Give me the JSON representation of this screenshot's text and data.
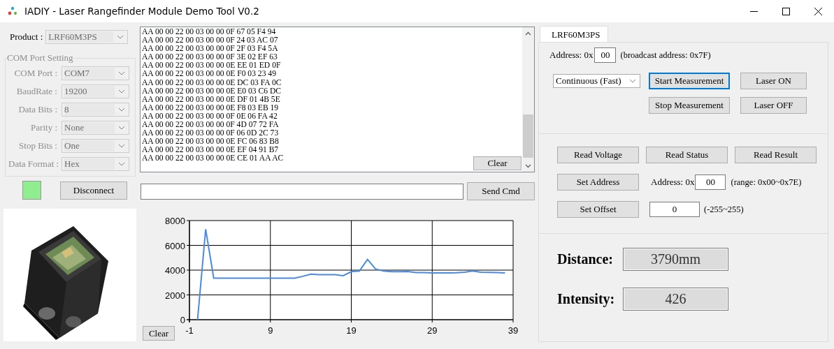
{
  "window": {
    "title": "IADIY - Laser Rangefinder Module Demo Tool V0.2"
  },
  "product": {
    "label": "Product :",
    "value": "LRF60M3PS",
    "disabled": true
  },
  "com_port_setting": {
    "title": "COM Port Setting",
    "disabled": true,
    "fields": [
      {
        "label": "COM Port :",
        "value": "COM7"
      },
      {
        "label": "BaudRate :",
        "value": "19200"
      },
      {
        "label": "Data Bits :",
        "value": "8"
      },
      {
        "label": "Parity :",
        "value": "None"
      },
      {
        "label": "Stop Bits :",
        "value": "One"
      },
      {
        "label": "Data Format :",
        "value": "Hex"
      }
    ]
  },
  "connection": {
    "connected": true,
    "button": "Disconnect"
  },
  "log": {
    "lines": [
      "AA 00 00 22 00 03 00 00 0F 67 05 F4 94",
      "AA 00 00 22 00 03 00 00 0F 24 03 AC 07",
      "AA 00 00 22 00 03 00 00 0F 2F 03 F4 5A",
      "AA 00 00 22 00 03 00 00 0F 3E 02 EF 63",
      "AA 00 00 22 00 03 00 00 0E EE 01 ED 0F",
      "AA 00 00 22 00 03 00 00 0E F0 03 23 49",
      "AA 00 00 22 00 03 00 00 0E DC 03 FA 0C",
      "AA 00 00 22 00 03 00 00 0E E0 03 C6 DC",
      "AA 00 00 22 00 03 00 00 0E DF 01 4B 5E",
      "AA 00 00 22 00 03 00 00 0E F8 03 EB 19",
      "AA 00 00 22 00 03 00 00 0F 0E 06 FA 42",
      "AA 00 00 22 00 03 00 00 0F 4D 07 72 FA",
      "AA 00 00 22 00 03 00 00 0F 06 0D 2C 73",
      "AA 00 00 22 00 03 00 00 0E FC 06 83 B8",
      "AA 00 00 22 00 03 00 00 0E EF 04 91 B7",
      "AA 00 00 22 00 03 00 00 0E CE 01 AA AC"
    ],
    "clear_button": "Clear"
  },
  "command": {
    "send_button": "Send Cmd"
  },
  "chart": {
    "clear_button": "Clear",
    "chart_data": {
      "type": "line",
      "x": [
        0,
        1,
        2,
        3,
        4,
        5,
        6,
        7,
        8,
        9,
        10,
        11,
        12,
        13,
        14,
        15,
        16,
        17,
        18,
        19,
        20,
        21,
        22,
        23,
        24,
        25,
        26,
        27,
        28,
        29,
        30,
        31,
        32,
        33,
        34,
        35,
        36,
        37,
        38
      ],
      "series": [
        {
          "color": "#4a8ae0",
          "values": [
            0,
            7300,
            3350,
            3350,
            3350,
            3350,
            3350,
            3350,
            3350,
            3350,
            3350,
            3350,
            3350,
            3500,
            3680,
            3630,
            3630,
            3630,
            3550,
            3870,
            3930,
            4870,
            4090,
            3930,
            3870,
            3870,
            3880,
            3800,
            3800,
            3780,
            3780,
            3780,
            3790,
            3830,
            3930,
            3830,
            3820,
            3800,
            3780
          ]
        }
      ],
      "xlim": [
        -1,
        39
      ],
      "ylim": [
        0,
        8000
      ],
      "xticks": [
        -1,
        9,
        19,
        29,
        39
      ],
      "yticks": [
        0,
        2000,
        4000,
        6000,
        8000
      ],
      "grid": true
    }
  },
  "device_panel": {
    "tabs": [
      {
        "label": "LRF60M3PS",
        "selected": true
      }
    ],
    "address": {
      "label": "Address: 0x",
      "value": "00",
      "hint": "(broadcast address: 0x7F)"
    },
    "mode": "Continuous (Fast)",
    "buttons": [
      {
        "label": "Start Measurement",
        "focused": true
      },
      {
        "label": "Laser ON",
        "focused": false
      },
      {
        "label": "Stop Measurement",
        "focused": false
      },
      {
        "label": "Laser OFF",
        "focused": false
      }
    ],
    "read_buttons": [
      "Read Voltage",
      "Read Status",
      "Read Result"
    ],
    "set_address": {
      "button": "Set Address",
      "label": "Address: 0x",
      "value": "00",
      "hint": "(range: 0x00~0x7E)"
    },
    "set_offset": {
      "button": "Set Offset",
      "value": "0",
      "hint": "(-255~255)"
    },
    "readings": [
      {
        "label": "Distance:",
        "value": "3790mm"
      },
      {
        "label": "Intensity:",
        "value": "426"
      }
    ]
  }
}
